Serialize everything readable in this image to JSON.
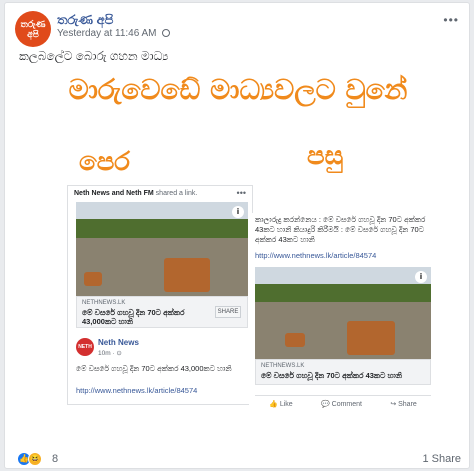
{
  "post": {
    "avatar_text": "තරුණ අපි",
    "page_name": "තරුණ අපි",
    "timestamp": "Yesterday at 11:46 AM",
    "more_label": "•••",
    "caption": "කලබලේට බොරු ගහන මාධ්‍ය",
    "reaction_count": "8",
    "shares": "1 Share"
  },
  "meme": {
    "headline": "මාරුවෙඩේ මාධ්‍යවලට වුනේ",
    "label_before": "පෙර",
    "label_after": "පසු"
  },
  "left_card": {
    "shared_by_names": "Neth News and Neth FM",
    "shared_by_suffix": " shared a link.",
    "dots": "•••",
    "link_domain": "NETHNEWS.LK",
    "link_title": "මේ වසරේ ගහවූ දින 70ට අක්කර 43,000කට හානි",
    "share_label": "SHARE",
    "page_logo": "NETH NEWS",
    "page_name": "Neth News",
    "time": "10m · ⊙",
    "post_text": "මේ වසරේ ගහවූ දින 70ට අක්කර 43,000කට හානි",
    "post_url": "http://www.nethnews.lk/article/84574"
  },
  "right_card": {
    "post_text": "කාලාරුදු කරන්නෙය : මේ වසරේ ගහවූ දින 70ට අක්කර 43කට හානි කියාදුරි කිරීමයි : මේ වසරේ ගහවූ දින 70ට අක්කර 43කට හානි",
    "post_url": "http://www.nethnews.lk/article/84574",
    "link_domain": "NETHNEWS.LK",
    "link_title": "මේ වසරේ ගහවූ දින 70ට අක්කර 43කට හානි",
    "actions": [
      "Like",
      "Comment",
      "Share"
    ]
  },
  "colors": {
    "accent_orange": "#f08a1c",
    "link_blue": "#385898"
  }
}
